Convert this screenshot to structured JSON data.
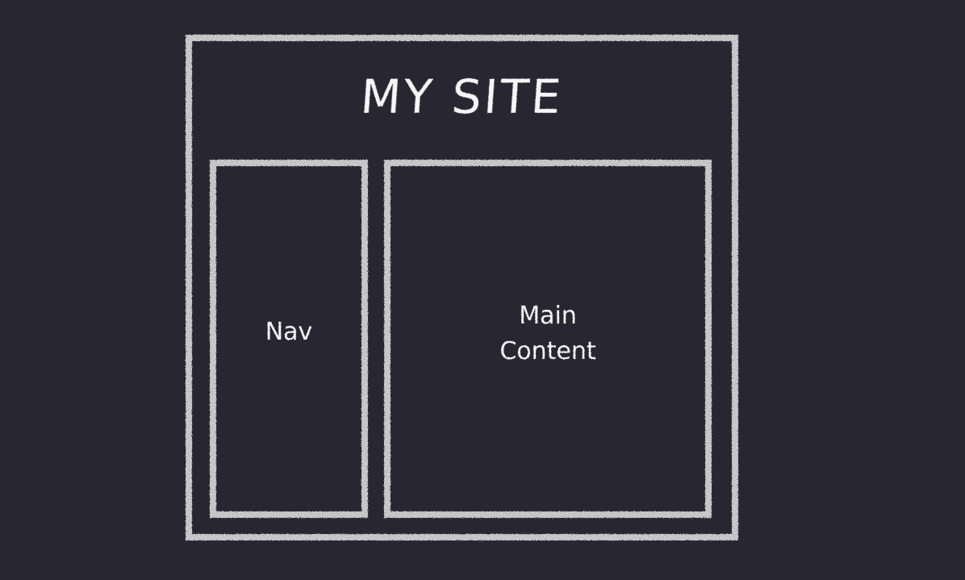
{
  "layout_sketch": {
    "header": {
      "title": "MY SITE"
    },
    "nav": {
      "label": "Nav"
    },
    "main": {
      "label_line1": "Main",
      "label_line2": "Content"
    }
  },
  "colors": {
    "background": "#282631",
    "chalk": "#f4f4f4"
  }
}
